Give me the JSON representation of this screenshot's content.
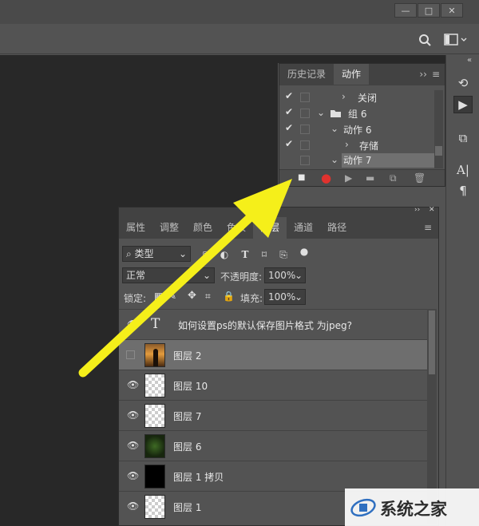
{
  "window": {
    "minimize": "—",
    "maximize": "□",
    "close": "✕"
  },
  "actions_panel": {
    "tabs": [
      "历史记录",
      "动作"
    ],
    "menu_glyph": "≡",
    "collapse_glyph": "››",
    "rows": [
      {
        "label": "关闭",
        "checked": true,
        "expanded": false
      },
      {
        "label": "组 6",
        "checked": true,
        "expanded": true,
        "folder": true
      },
      {
        "label": "动作 6",
        "checked": true,
        "expanded": true
      },
      {
        "label": "存储",
        "checked": true,
        "expanded": false
      },
      {
        "label": "动作 7",
        "checked": false,
        "expanded": true,
        "selected": true
      }
    ]
  },
  "layers_panel": {
    "tabs": [
      "属性",
      "调整",
      "颜色",
      "色板",
      "图层",
      "通道",
      "路径"
    ],
    "active_tab": "图层",
    "filter_label": "类型",
    "blend_mode": "正常",
    "opacity_label": "不透明度:",
    "opacity_value": "100%",
    "lock_label": "锁定:",
    "fill_label": "填充:",
    "fill_value": "100%",
    "layers": [
      {
        "name": "如何设置ps的默认保存图片格式 为jpeg?",
        "visible": true,
        "type": "text"
      },
      {
        "name": "图层 2",
        "visible": false,
        "type": "photo",
        "selected": true
      },
      {
        "name": "图层 10",
        "visible": true,
        "type": "transparent"
      },
      {
        "name": "图层 7",
        "visible": true,
        "type": "transparent"
      },
      {
        "name": "图层 6",
        "visible": true,
        "type": "dark-green"
      },
      {
        "name": "图层 1 拷贝",
        "visible": true,
        "type": "black"
      },
      {
        "name": "图层 1",
        "visible": true,
        "type": "transparent"
      }
    ]
  },
  "watermark": {
    "text": "系统之家"
  },
  "colors": {
    "arrow": "#f5ef1a",
    "record": "#e0322e",
    "panel_bg": "#535353",
    "canvas_bg": "#282828"
  }
}
